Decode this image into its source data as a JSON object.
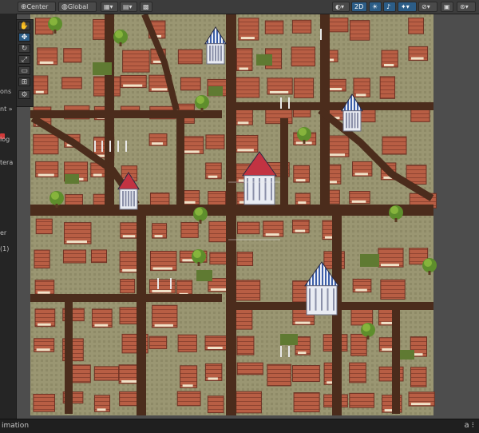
{
  "toolbar": {
    "pivot_label": "Center",
    "handle_label": "Global",
    "mode_2d_label": "2D"
  },
  "left_panel": {
    "fragments": [
      "ons",
      "nt »",
      "log",
      "tera",
      "er",
      "(1)"
    ]
  },
  "status": {
    "text": "imation",
    "right_icons": "a ⁝"
  },
  "colors": {
    "roof": "#b85e44",
    "roof_dark": "#7e3a2b",
    "road": "#4b2c1c",
    "ground": "#9a9672",
    "accent": "#2c5d87"
  },
  "icons": [
    "pivot-icon",
    "global-icon",
    "grid-snap-icon",
    "hand-tool-icon",
    "move-tool-icon",
    "rotate-tool-icon",
    "scale-tool-icon",
    "rect-tool-icon",
    "transform-tool-icon",
    "light-icon",
    "audio-icon",
    "effects-icon",
    "visibility-icon",
    "gizmos-icon"
  ]
}
